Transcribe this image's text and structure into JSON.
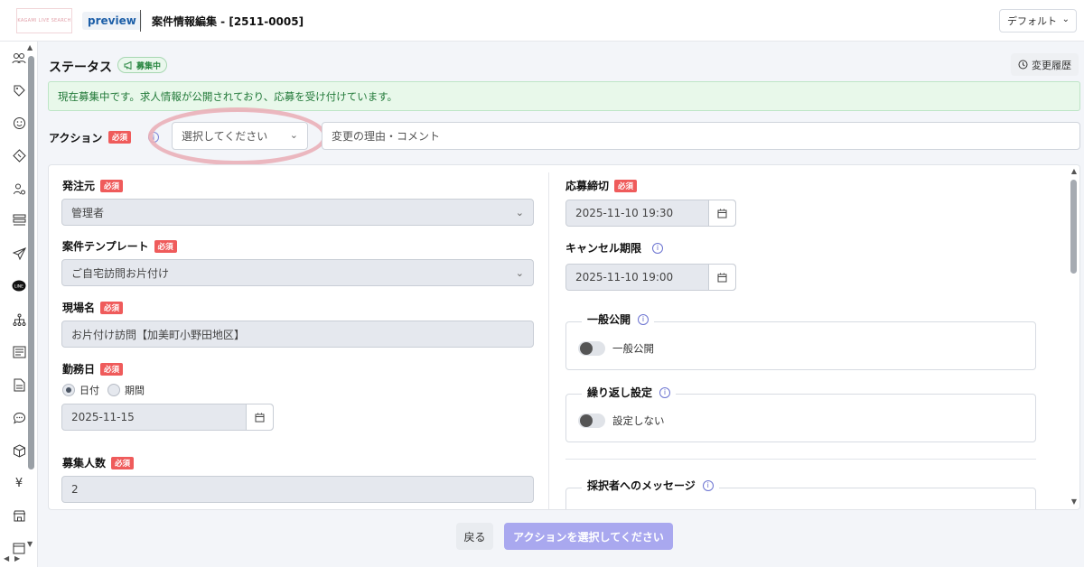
{
  "header": {
    "logo_text": "KAGAMI LIVE SEARCH",
    "preview_label": "preview",
    "title": "案件情報編集 - [2511-0005]",
    "view_select": "デフォルト"
  },
  "status": {
    "title": "ステータス",
    "badge": "募集中",
    "history_button": "変更履歴",
    "notice": "現在募集中です。求人情報が公開されており、応募を受け付けています。"
  },
  "action": {
    "label": "アクション",
    "required": "必須",
    "select_placeholder": "選択してください",
    "comment_placeholder": "変更の理由・コメント"
  },
  "form": {
    "required": "必須",
    "client": {
      "label": "発注元",
      "value": "管理者"
    },
    "template": {
      "label": "案件テンプレート",
      "value": "ご自宅訪問お片付け"
    },
    "site": {
      "label": "現場名",
      "value": "お片付け訪問【加美町小野田地区】"
    },
    "workday": {
      "label": "勤務日",
      "option_date": "日付",
      "option_period": "期間",
      "value": "2025-11-15"
    },
    "headcount": {
      "label": "募集人数",
      "value": "2"
    },
    "deadline": {
      "label": "応募締切",
      "value": "2025-11-10 19:30"
    },
    "cancel": {
      "label": "キャンセル期限",
      "value": "2025-11-10 19:00"
    },
    "public": {
      "legend": "一般公開",
      "toggle_label": "一般公開"
    },
    "repeat": {
      "legend": "繰り返し設定",
      "toggle_label": "設定しない"
    },
    "message": {
      "legend": "採択者へのメッセージ"
    }
  },
  "footer": {
    "back": "戻る",
    "submit": "アクションを選択してください"
  }
}
